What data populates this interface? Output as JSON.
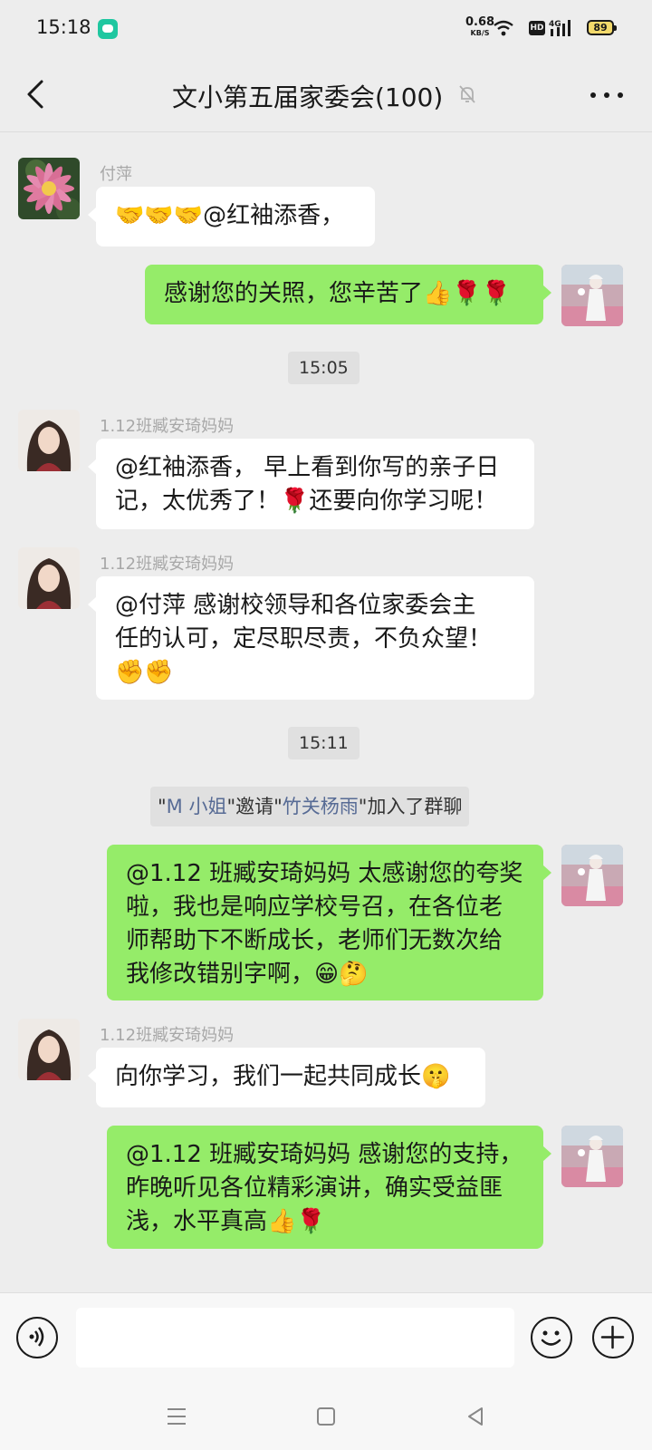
{
  "status_bar": {
    "time": "15:18",
    "net_speed_value": "0.68",
    "net_speed_unit": "KB/S",
    "hd_label": "HD",
    "signal_label": "4G",
    "battery_level": "89"
  },
  "header": {
    "title": "文小第五届家委会(100)",
    "muted": true
  },
  "messages": [
    {
      "type": "in",
      "sender": "付萍",
      "avatar": "flower-avatar",
      "text": "🤝🤝🤝@红袖添香，"
    },
    {
      "type": "out",
      "avatar": "self-avatar",
      "text": "感谢您的关照，您辛苦了👍🌹🌹"
    },
    {
      "type": "time",
      "text": "15:05"
    },
    {
      "type": "in",
      "sender": "1.12班臧安琦妈妈",
      "avatar": "girl-avatar",
      "lines": [
        "@红袖添香，  早上看到你写的亲子日",
        "记，太优秀了！🌹还要向你学习呢！"
      ]
    },
    {
      "type": "in",
      "sender": "1.12班臧安琦妈妈",
      "avatar": "girl-avatar",
      "lines": [
        "@付萍  感谢校领导和各位家委会主",
        "任的认可，定尽职尽责，不负众望！",
        "✊✊"
      ]
    },
    {
      "type": "time",
      "text": "15:11"
    },
    {
      "type": "system",
      "quote_open": "\"",
      "inviter": "M 小姐",
      "mid": "\"邀请\"",
      "invitee": "竹关杨雨",
      "tail": "\"加入了群聊"
    },
    {
      "type": "out",
      "avatar": "self-avatar",
      "lines": [
        "@1.12 班臧安琦妈妈  太感谢您的夸奖",
        "啦，我也是响应学校号召，在各位老",
        "师帮助下不断成长，老师们无数次给",
        "我修改错别字啊，😁🤔"
      ]
    },
    {
      "type": "in",
      "sender": "1.12班臧安琦妈妈",
      "avatar": "girl-avatar",
      "text": "向你学习，我们一起共同成长🤫"
    },
    {
      "type": "out",
      "avatar": "self-avatar",
      "lines": [
        "@1.12 班臧安琦妈妈  感谢您的支持，",
        "昨晚听见各位精彩演讲，确实受益匪",
        "浅，水平真高👍🌹"
      ]
    }
  ],
  "input": {
    "placeholder": ""
  },
  "icons": {
    "voice": "voice-icon",
    "emoji": "emoji-icon",
    "plus": "plus-icon",
    "menu": "nav-menu-icon",
    "home": "nav-home-icon",
    "back": "nav-back-icon"
  },
  "colors": {
    "background": "#ededed",
    "bubble_out": "#95ec69",
    "bubble_in": "#ffffff",
    "link_name": "#576b95"
  }
}
